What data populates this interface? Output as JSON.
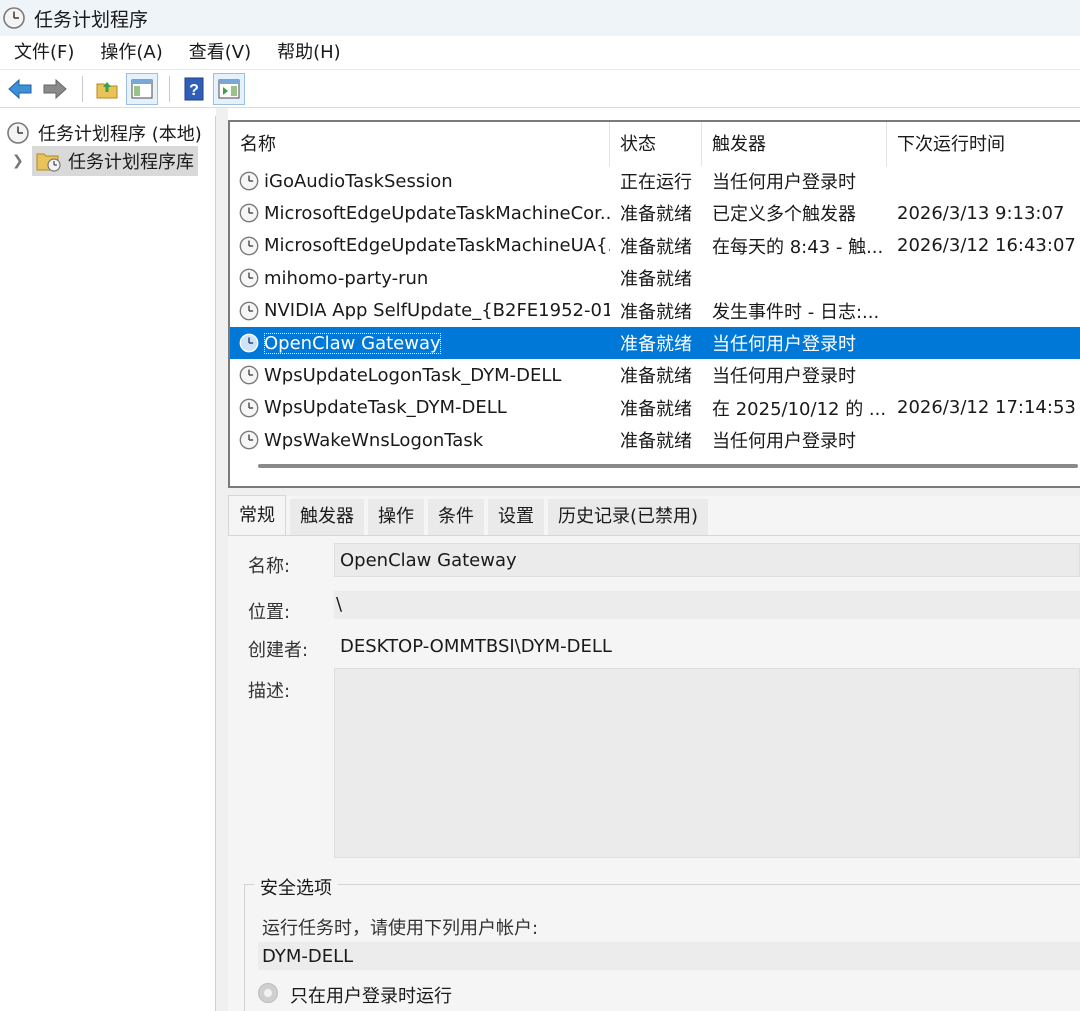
{
  "window": {
    "title": "任务计划程序"
  },
  "menu": {
    "items": [
      "文件(F)",
      "操作(A)",
      "查看(V)",
      "帮助(H)"
    ]
  },
  "toolbar": {
    "icons": [
      "back-arrow-icon",
      "forward-arrow-icon",
      "folder-up-icon",
      "show-hide-tree-icon",
      "help-icon",
      "show-hide-action-pane-icon"
    ]
  },
  "tree": {
    "root_label": "任务计划程序 (本地)",
    "library_label": "任务计划程序库"
  },
  "tasklist": {
    "columns": [
      "名称",
      "状态",
      "触发器",
      "下次运行时间"
    ],
    "rows": [
      {
        "name": "iGoAudioTaskSession",
        "status": "正在运行",
        "trigger": "当任何用户登录时",
        "next": ""
      },
      {
        "name": "MicrosoftEdgeUpdateTaskMachineCor...",
        "status": "准备就绪",
        "trigger": "已定义多个触发器",
        "next": "2026/3/13 9:13:07"
      },
      {
        "name": "MicrosoftEdgeUpdateTaskMachineUA{...",
        "status": "准备就绪",
        "trigger": "在每天的 8:43 - 触...",
        "next": "2026/3/12 16:43:07"
      },
      {
        "name": "mihomo-party-run",
        "status": "准备就绪",
        "trigger": "",
        "next": ""
      },
      {
        "name": "NVIDIA App SelfUpdate_{B2FE1952-01...",
        "status": "准备就绪",
        "trigger": "发生事件时 - 日志:...",
        "next": ""
      },
      {
        "name": "OpenClaw Gateway",
        "status": "准备就绪",
        "trigger": "当任何用户登录时",
        "next": ""
      },
      {
        "name": "WpsUpdateLogonTask_DYM-DELL",
        "status": "准备就绪",
        "trigger": "当任何用户登录时",
        "next": ""
      },
      {
        "name": "WpsUpdateTask_DYM-DELL",
        "status": "准备就绪",
        "trigger": "在 2025/10/12 的 ...",
        "next": "2026/3/12 17:14:53"
      },
      {
        "name": "WpsWakeWnsLogonTask",
        "status": "准备就绪",
        "trigger": "当任何用户登录时",
        "next": ""
      }
    ],
    "selected_index": 5
  },
  "detail": {
    "tabs": [
      "常规",
      "触发器",
      "操作",
      "条件",
      "设置",
      "历史记录(已禁用)"
    ],
    "active_tab": "常规",
    "name_label": "名称:",
    "name_value": "OpenClaw Gateway",
    "location_label": "位置:",
    "location_value": "\\",
    "author_label": "创建者:",
    "author_value": "DESKTOP-OMMTBSI\\DYM-DELL",
    "description_label": "描述:",
    "description_value": "",
    "security": {
      "title": "安全选项",
      "run_as_label": "运行任务时，请使用下列用户帐户:",
      "run_as_value": "DYM-DELL",
      "radio_logged_on_only": "只在用户登录时运行"
    }
  },
  "colors": {
    "selection": "#0078d7",
    "titlebar": "#eff4f9"
  }
}
